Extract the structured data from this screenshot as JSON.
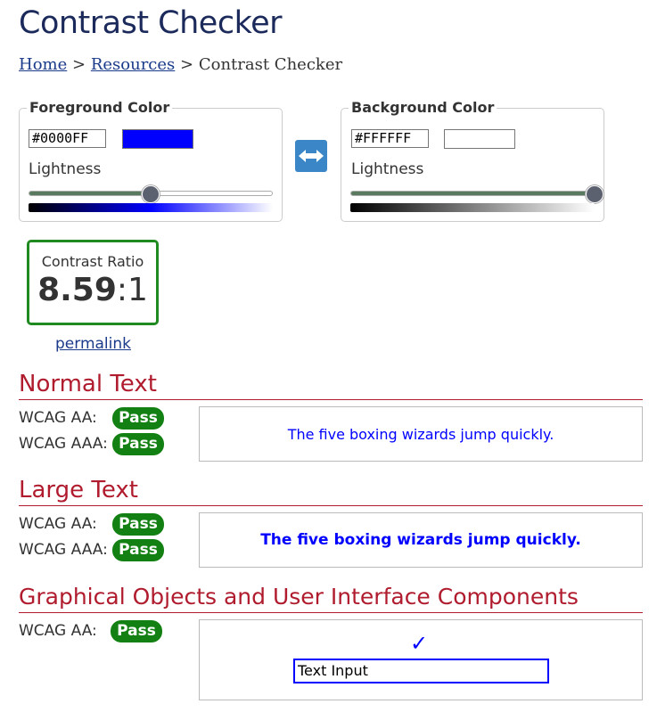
{
  "page": {
    "title": "Contrast Checker"
  },
  "breadcrumb": {
    "home": "Home",
    "separator1": ">",
    "resources": "Resources",
    "separator2": ">",
    "current": "Contrast Checker"
  },
  "foreground": {
    "legend": "Foreground Color",
    "hex_value": "#0000FF",
    "swatch_color": "#0000FF",
    "lightness_label": "Lightness",
    "lightness_percent": 50
  },
  "background": {
    "legend": "Background Color",
    "hex_value": "#FFFFFF",
    "swatch_color": "#FFFFFF",
    "lightness_label": "Lightness",
    "lightness_percent": 100
  },
  "swap": {
    "icon": "swap-arrows-icon"
  },
  "contrast": {
    "label": "Contrast Ratio",
    "ratio_bold": "8.59",
    "ratio_suffix": ":1"
  },
  "permalink": "permalink",
  "sections": {
    "normal": {
      "heading": "Normal Text",
      "aa_label": "WCAG AA:",
      "aa_result": "Pass",
      "aaa_label": "WCAG AAA:",
      "aaa_result": "Pass",
      "sample": "The five boxing wizards jump quickly."
    },
    "large": {
      "heading": "Large Text",
      "aa_label": "WCAG AA:",
      "aa_result": "Pass",
      "aaa_label": "WCAG AAA:",
      "aaa_result": "Pass",
      "sample": "The five boxing wizards jump quickly."
    },
    "graphical": {
      "heading": "Graphical Objects and User Interface Components",
      "aa_label": "WCAG AA:",
      "aa_result": "Pass",
      "check_glyph": "✓",
      "input_value": "Text Input"
    }
  },
  "colors": {
    "pass": "#138013",
    "heading": "#b01c2e",
    "title": "#1b2a5b",
    "link": "#1a3a8a",
    "sample_fg": "#0000FF"
  }
}
